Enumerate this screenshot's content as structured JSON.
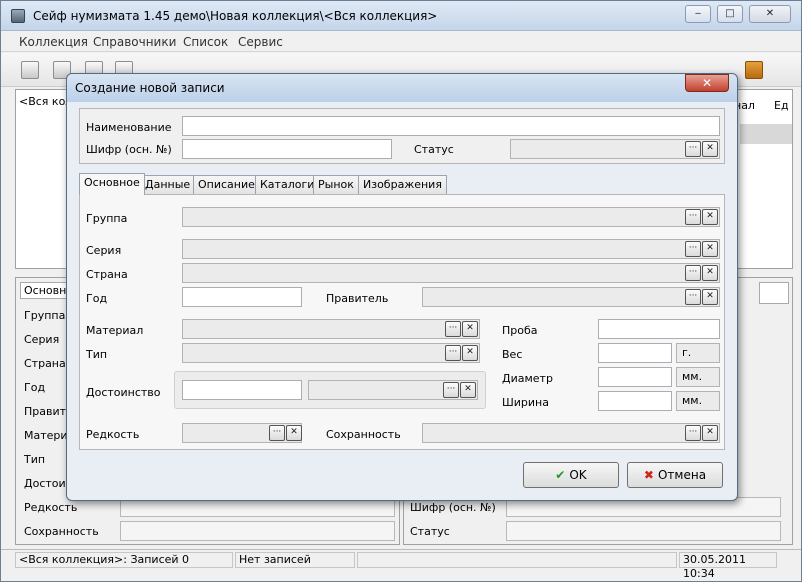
{
  "app": {
    "title": "Сейф нумизмата 1.45 демо\\Новая коллекция\\<Вся коллекция>",
    "window_buttons": {
      "minimize": "‒",
      "maximize": "□",
      "close": "✕"
    },
    "menu": [
      "Коллекция",
      "Справочники",
      "Список",
      "Сервис"
    ],
    "tree_root": "<Вся кол",
    "right_header": [
      "нал",
      "Ед"
    ],
    "lower_tab": "Основное",
    "lower_labels": [
      "Группа",
      "Серия",
      "Страна",
      "Год",
      "Правите",
      "Материа",
      "Тип",
      "Достоин",
      "Редкость",
      "Сохранность"
    ],
    "lower_right_labels": [
      "Шифр (осн. №)",
      "Статус"
    ]
  },
  "status": {
    "collection": "<Вся коллекция>: Записей 0",
    "records": "Нет записей",
    "datetime": "30.05.2011 10:34"
  },
  "dialog": {
    "title": "Создание новой записи",
    "close": "✕",
    "name_label": "Наименование",
    "name_value": "",
    "code_label": "Шифр (осн. №)",
    "code_value": "",
    "status_label": "Статус",
    "status_value": "",
    "tabs": [
      "Основное",
      "Данные",
      "Описание",
      "Каталоги",
      "Рынок",
      "Изображения"
    ],
    "fields": {
      "group": "Группа",
      "series": "Серия",
      "country": "Страна",
      "year": "Год",
      "ruler": "Правитель",
      "material": "Материал",
      "type": "Тип",
      "denomination": "Достоинство",
      "rarity": "Редкость",
      "preservation": "Сохранность",
      "fineness": "Проба",
      "weight": "Вес",
      "diameter": "Диаметр",
      "width": "Ширина"
    },
    "units": {
      "weight": "г.",
      "diameter": "мм.",
      "width": "мм."
    },
    "picker_glyph": "···",
    "clear_glyph": "✕",
    "ok_label": "OK",
    "cancel_label": "Отмена",
    "ok_glyph": "✔",
    "cancel_glyph": "✖"
  }
}
